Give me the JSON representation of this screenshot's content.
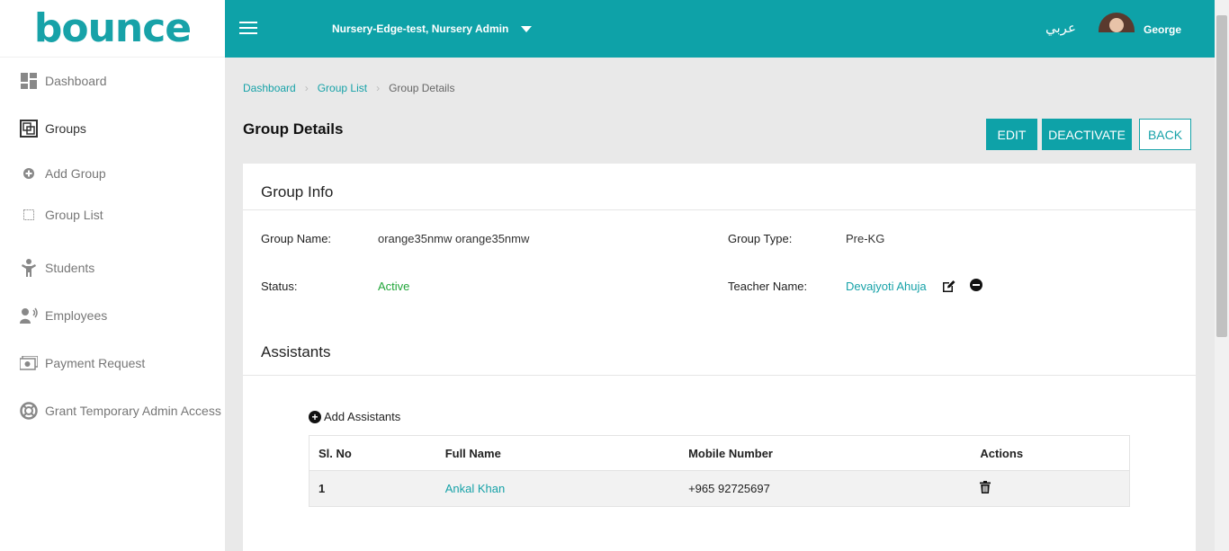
{
  "app": {
    "logo": "bounce"
  },
  "sidebar": {
    "items": [
      {
        "label": "Dashboard",
        "icon": "dashboard-icon"
      },
      {
        "label": "Groups",
        "icon": "groups-icon"
      },
      {
        "label": "Add Group",
        "icon": "plus-circle-icon"
      },
      {
        "label": "Group List",
        "icon": "list-icon"
      },
      {
        "label": "Students",
        "icon": "student-icon"
      },
      {
        "label": "Employees",
        "icon": "employee-icon"
      },
      {
        "label": "Payment Request",
        "icon": "money-icon"
      },
      {
        "label": "Grant Temporary Admin Access",
        "icon": "lifebuoy-icon"
      }
    ]
  },
  "header": {
    "nursery": "Nursery-Edge-test, Nursery Admin",
    "language": "عربي",
    "username": "George",
    "accent_color": "#0ea2a8"
  },
  "breadcrumb": {
    "items": [
      "Dashboard",
      "Group List"
    ],
    "current": "Group Details"
  },
  "page": {
    "title": "Group Details"
  },
  "actions": {
    "edit": "EDIT",
    "deactivate": "DEACTIVATE",
    "back": "BACK"
  },
  "group_info": {
    "title": "Group Info",
    "group_name_label": "Group Name:",
    "group_name": "orange35nmw orange35nmw",
    "group_type_label": "Group Type:",
    "group_type": "Pre-KG",
    "status_label": "Status:",
    "status": "Active",
    "teacher_label": "Teacher Name:",
    "teacher": "Devajyoti Ahuja"
  },
  "assistants": {
    "title": "Assistants",
    "add_label": "Add Assistants",
    "columns": [
      "Sl. No",
      "Full Name",
      "Mobile Number",
      "Actions"
    ],
    "rows": [
      {
        "sl": "1",
        "name": "Ankal Khan",
        "mobile": "+965 92725697"
      }
    ]
  }
}
